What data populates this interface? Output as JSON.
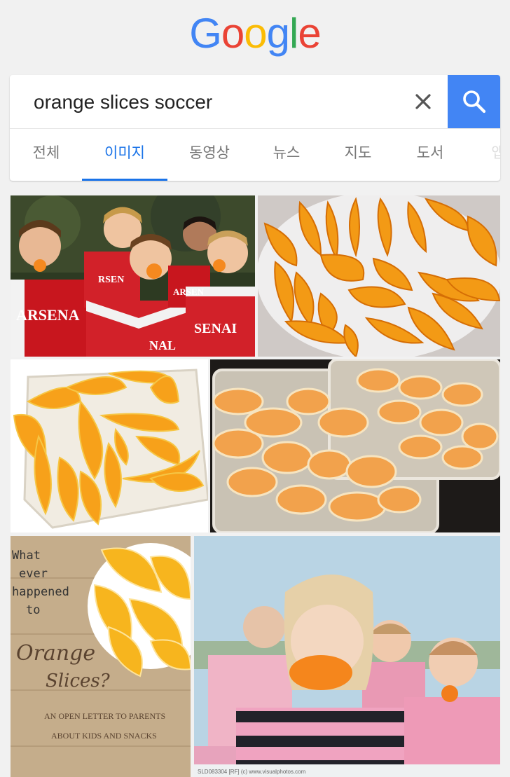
{
  "logo": {
    "letters": [
      "G",
      "o",
      "o",
      "g",
      "l",
      "e"
    ],
    "colors": [
      "#4285F4",
      "#EA4335",
      "#FBBC05",
      "#4285F4",
      "#34A853",
      "#EA4335"
    ]
  },
  "search": {
    "query": "orange slices soccer"
  },
  "colors": {
    "accent": "#4285f4",
    "active_tab": "#1a73e8"
  },
  "tabs": [
    {
      "label": "전체"
    },
    {
      "label": "이미지"
    },
    {
      "label": "동영상"
    },
    {
      "label": "뉴스"
    },
    {
      "label": "지도"
    },
    {
      "label": "도서"
    },
    {
      "label": "앱"
    }
  ],
  "active_tab": "이미지",
  "results": {
    "r1": {
      "jersey_1": "ARSENA",
      "jersey_2": "RSEN",
      "jersey_3": "ARSEN",
      "jersey_4": "RSENAL",
      "jersey_5": "SENAI",
      "jersey_6": "NAL"
    },
    "r5": {
      "line1": "What",
      "line2": "ever",
      "line3": "happened",
      "line4": "to",
      "line5": "Orange",
      "line6": "Slices?",
      "line7": "AN OPEN LETTER TO PARENTS",
      "line8": "ABOUT KIDS AND SNACKS"
    },
    "r6": {
      "caption": "SLD083304 [RF] (c) www.visualphotos.com"
    }
  }
}
